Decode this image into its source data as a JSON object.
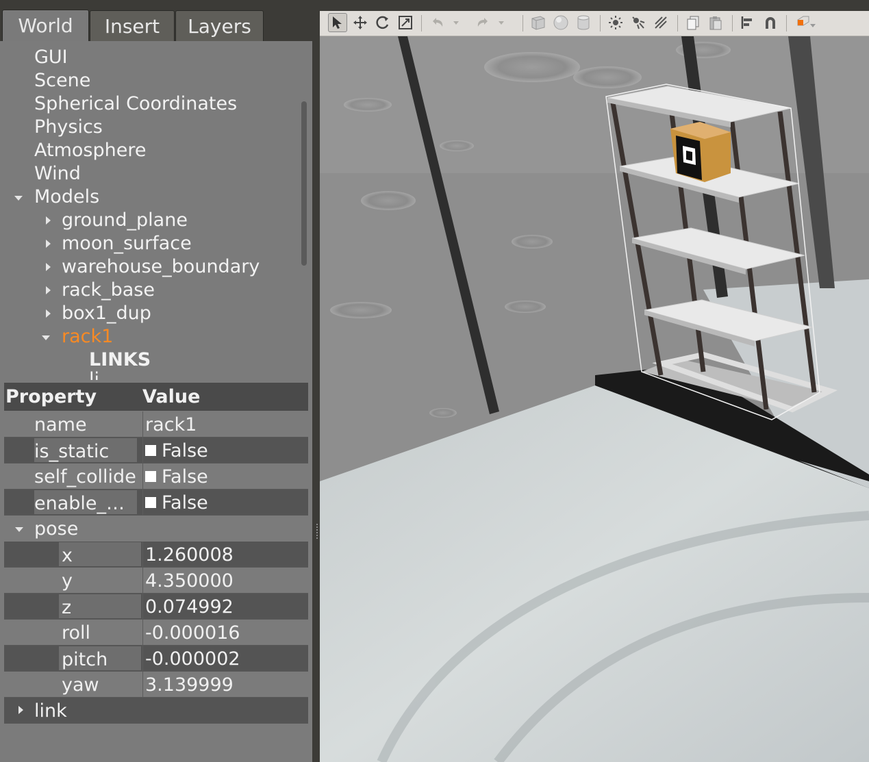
{
  "tabs": [
    {
      "label": "World",
      "active": true
    },
    {
      "label": "Insert",
      "active": false
    },
    {
      "label": "Layers",
      "active": false
    }
  ],
  "tree": {
    "top_items": [
      "GUI",
      "Scene",
      "Spherical Coordinates",
      "Physics",
      "Atmosphere",
      "Wind"
    ],
    "models_label": "Models",
    "models": [
      "ground_plane",
      "moon_surface",
      "warehouse_boundary",
      "rack_base",
      "box1_dup"
    ],
    "selected_model": "rack1",
    "links_header": "LINKS",
    "links_partial": "li..."
  },
  "properties": {
    "header_property": "Property",
    "header_value": "Value",
    "name_key": "name",
    "name_value": "rack1",
    "is_static_key": "is_static",
    "is_static_value": "False",
    "self_collide_key": "self_collide",
    "self_collide_value": "False",
    "enable_key": "enable_…",
    "enable_value": "False",
    "pose_label": "pose",
    "pose": {
      "x": "1.260008",
      "y": "4.350000",
      "z": "0.074992",
      "roll": "-0.000016",
      "pitch": "-0.000002",
      "yaw": "3.139999"
    },
    "pose_keys": {
      "x": "x",
      "y": "y",
      "z": "z",
      "roll": "roll",
      "pitch": "pitch",
      "yaw": "yaw"
    },
    "link_label": "link"
  },
  "toolbar": {
    "icons": [
      "select-arrow-icon",
      "translate-icon",
      "rotate-icon",
      "scale-icon",
      "undo-icon",
      "undo-history-icon",
      "redo-icon",
      "redo-history-icon",
      "box-shape-icon",
      "sphere-shape-icon",
      "cylinder-shape-icon",
      "point-light-icon",
      "spot-light-icon",
      "directional-light-icon",
      "copy-icon",
      "paste-icon",
      "align-icon",
      "snap-magnet-icon",
      "view-angle-icon"
    ]
  },
  "colors": {
    "selected_text": "#f98a24",
    "panel_bg": "#7b7b7b",
    "toolbar_bg": "#e0ddd9"
  }
}
